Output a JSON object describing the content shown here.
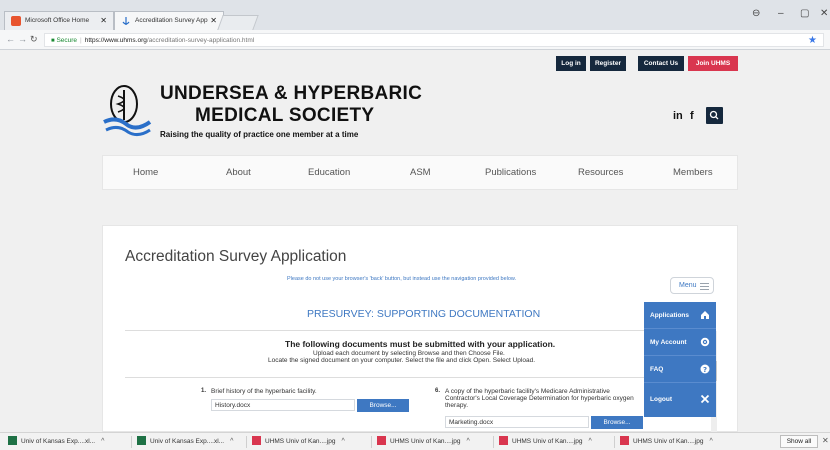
{
  "browser": {
    "tabs": [
      {
        "title": "Microsoft Office Home",
        "active": false
      },
      {
        "title": "Accreditation Survey App",
        "active": true
      }
    ],
    "url": {
      "secure_label": "Secure",
      "host": "https://www.uhms.org",
      "path": "/accreditation-survey-application.html"
    }
  },
  "site": {
    "top_links": [
      "Log in",
      "Register",
      "Contact Us",
      "Join UHMS"
    ],
    "title_line1": "UNDERSEA & HYPERBARIC",
    "title_line2": "MEDICAL SOCIETY",
    "tagline": "Raising the quality of practice one member at a time",
    "social": [
      "in",
      "f"
    ],
    "nav": [
      "Home",
      "About",
      "Education",
      "ASM",
      "Publications",
      "Resources",
      "Members"
    ]
  },
  "form": {
    "title": "Accreditation Survey Application",
    "notice": "Please do not use your browser's 'back' button, but instead use the navigation provided below.",
    "menu_label": "Menu",
    "section_heading": "PRESURVEY: SUPPORTING DOCUMENTATION",
    "requirement_title": "The following documents must be submitted with your application.",
    "requirement_line2": "Upload each document by selecting Browse and then Choose File.",
    "requirement_line3": "Locate the signed document on your computer. Select the file and click Open. Select Upload.",
    "documents": [
      {
        "number": "1.",
        "label": "Brief history of the hyperbaric facility.",
        "file": "History.docx",
        "button": "Browse..."
      },
      {
        "number": "6.",
        "label": "A copy of the hyperbaric facility's Medicare Administrative Contractor's Local Coverage Determination for hyperbaric oxygen therapy.",
        "file": "Marketing.docx",
        "button": "Browse..."
      }
    ]
  },
  "side_menu": [
    {
      "label": "Applications",
      "icon": "home-icon"
    },
    {
      "label": "My Account",
      "icon": "gear-icon"
    },
    {
      "label": "FAQ",
      "icon": "question-icon"
    },
    {
      "label": "Logout",
      "icon": "close-icon"
    }
  ],
  "downloads": {
    "items": [
      "Univ of Kansas Exp....xl...",
      "Univ of Kansas Exp....xl...",
      "UHMS Univ of Kan....jpg",
      "UHMS Univ of Kan....jpg",
      "UHMS Univ of Kan....jpg",
      "UHMS Univ of Kan....jpg"
    ],
    "show_all": "Show all"
  },
  "colors": {
    "navy": "#15283d",
    "join_red": "#d9364f",
    "accent_blue": "#3e78c2"
  }
}
